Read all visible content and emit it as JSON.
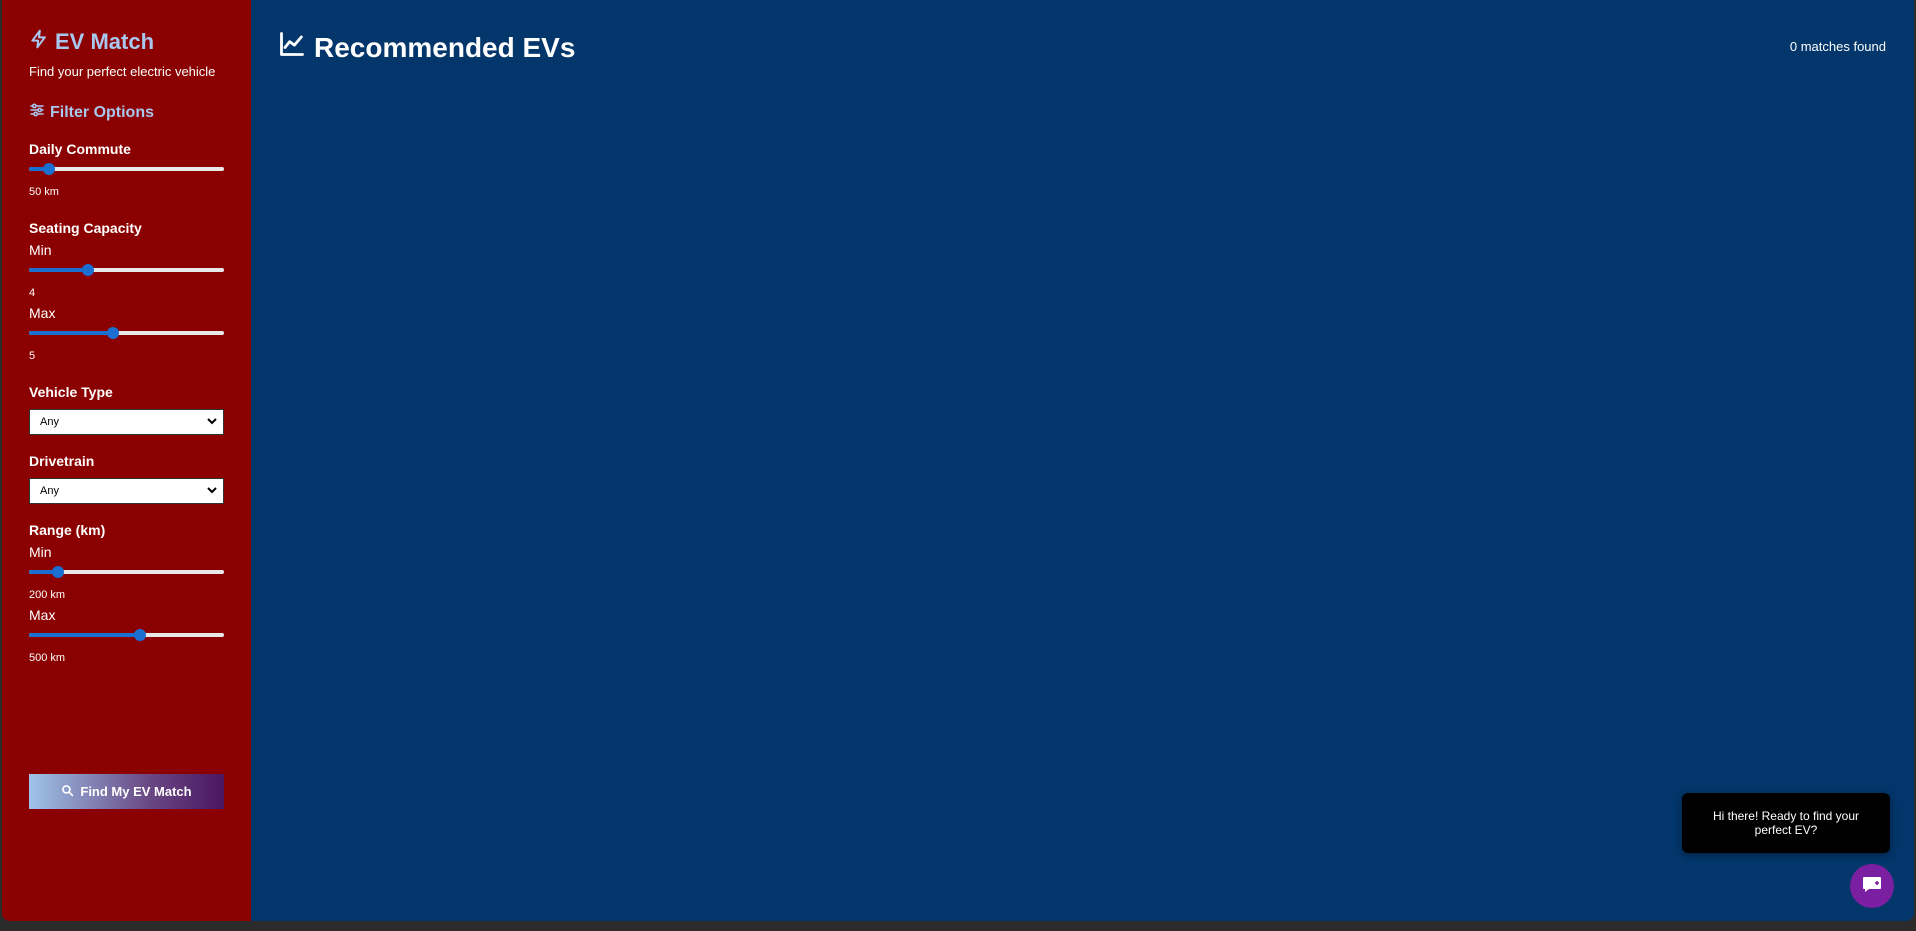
{
  "brand": {
    "title": "EV Match",
    "tagline": "Find your perfect electric vehicle"
  },
  "filters": {
    "heading": "Filter Options",
    "commute": {
      "label": "Daily Commute",
      "value": "50 km",
      "fraction": 0.1
    },
    "seating": {
      "label": "Seating Capacity",
      "min": {
        "label": "Min",
        "value": "4",
        "fraction": 0.3
      },
      "max": {
        "label": "Max",
        "value": "5",
        "fraction": 0.43
      }
    },
    "vehicle_type": {
      "label": "Vehicle Type",
      "selected": "Any"
    },
    "drivetrain": {
      "label": "Drivetrain",
      "selected": "Any"
    },
    "range": {
      "label": "Range (km)",
      "min": {
        "label": "Min",
        "value": "200 km",
        "fraction": 0.15
      },
      "max": {
        "label": "Max",
        "value": "500 km",
        "fraction": 0.57
      }
    },
    "find_button": "Find My EV Match"
  },
  "main": {
    "title": "Recommended EVs",
    "match_count": "0 matches found"
  },
  "chat": {
    "message": "Hi there! Ready to find your perfect EV?"
  },
  "colors": {
    "sidebar": "#8b0000",
    "main": "#03366b",
    "accent": "#a8c8f0",
    "slider": "#1a6fd1",
    "chat": "#7a1fa2"
  }
}
